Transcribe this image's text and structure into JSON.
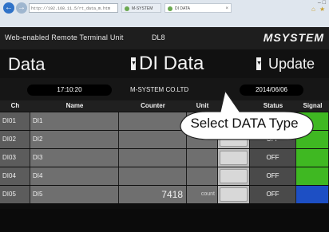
{
  "browser": {
    "address": "http://192.168.11.5/rt_data_m.htm",
    "tabs": [
      {
        "label": "M-SYSTEM"
      },
      {
        "label": "DI DATA"
      }
    ]
  },
  "header": {
    "title": "Web-enabled Remote Terminal Unit",
    "model": "DL8",
    "logo": "MSYSTEM"
  },
  "titlebar": {
    "page": "Data",
    "selector": "DI Data",
    "update": "Update"
  },
  "info": {
    "time": "17:10:20",
    "company": "M-SYSTEM CO.LTD",
    "date": "2014/06/06"
  },
  "table": {
    "columns": [
      "Ch",
      "Name",
      "Counter",
      "Unit",
      "",
      "Status",
      "Signal"
    ],
    "rows": [
      {
        "ch": "DI01",
        "name": "DI1",
        "counter": "",
        "unit": "",
        "status": "",
        "signal": "#3fb822"
      },
      {
        "ch": "DI02",
        "name": "DI2",
        "counter": "",
        "unit": "",
        "status": "OFF",
        "signal": "#3fb822"
      },
      {
        "ch": "DI03",
        "name": "DI3",
        "counter": "",
        "unit": "",
        "status": "OFF",
        "signal": "#3fb822"
      },
      {
        "ch": "DI04",
        "name": "DI4",
        "counter": "",
        "unit": "",
        "status": "OFF",
        "signal": "#3fb822"
      },
      {
        "ch": "DI05",
        "name": "DI5",
        "counter": "7418",
        "unit": "count",
        "status": "OFF",
        "signal": "#1d4fc4"
      }
    ]
  },
  "callout": {
    "text": "Select DATA Type"
  }
}
